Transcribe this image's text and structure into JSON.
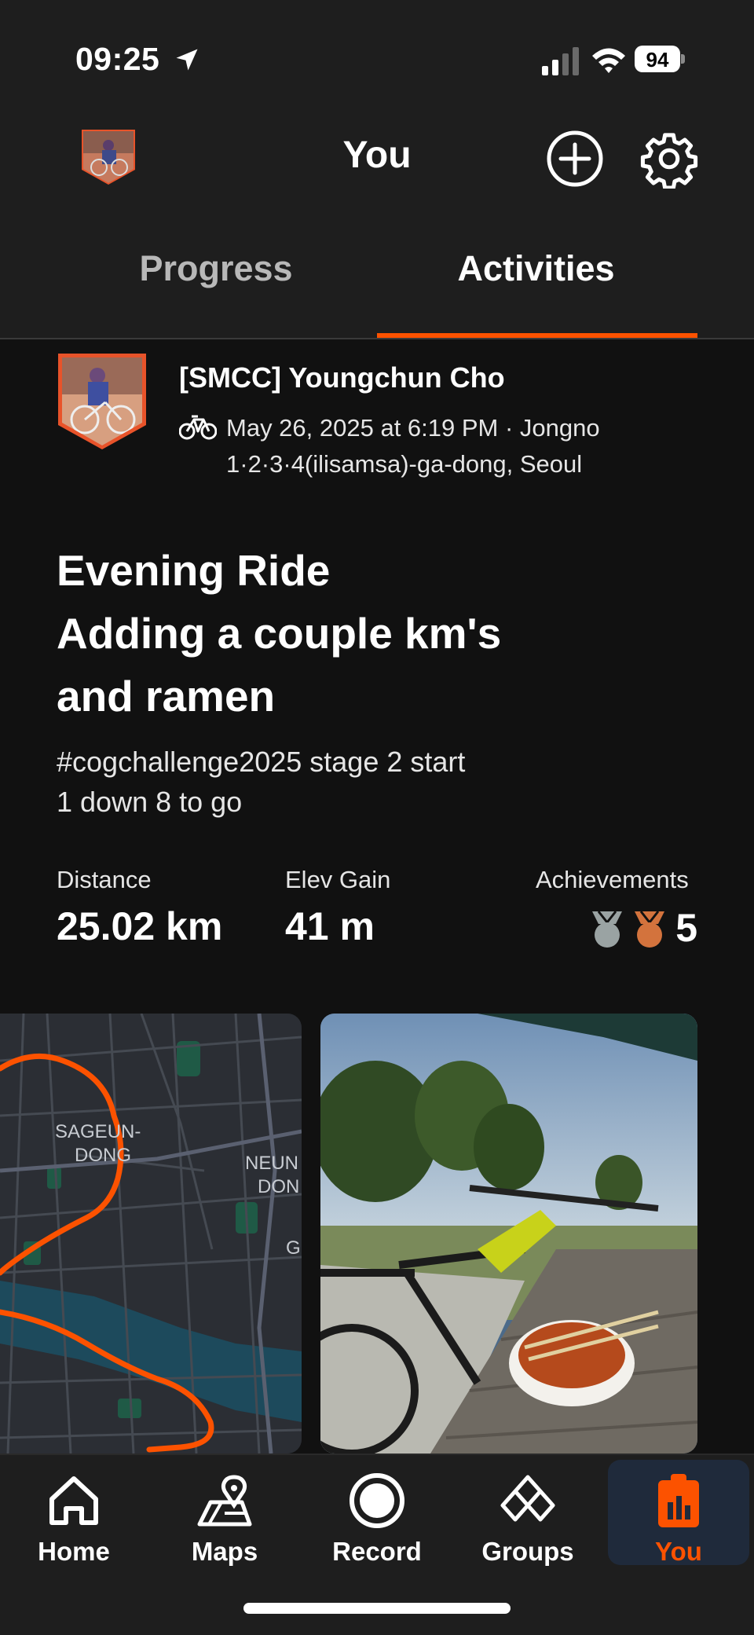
{
  "status_bar": {
    "time": "09:25",
    "battery": "94"
  },
  "header": {
    "title": "You"
  },
  "tabs": [
    {
      "label": "Progress",
      "active": false
    },
    {
      "label": "Activities",
      "active": true
    }
  ],
  "activity": {
    "athlete": "[SMCC] Youngchun Cho",
    "meta_line1": "May 26, 2025 at 6:19 PM · Jongno",
    "meta_line2": "1·2·3·4(ilisamsa)-ga-dong, Seoul",
    "title_line1": "Evening Ride",
    "title_line2": "Adding a couple km's",
    "title_line3": "and ramen",
    "desc_line1": "#cogchallenge2025 stage 2 start",
    "desc_line2": "1 down 8 to go",
    "stats": {
      "distance_label": "Distance",
      "distance_value": "25.02 km",
      "elev_label": "Elev Gain",
      "elev_value": "41 m",
      "ach_label": "Achievements",
      "ach_value": "5"
    },
    "map_labels": {
      "area1_line1": "SAGEUN-",
      "area1_line2": "DONG",
      "area2_line1": "NEUN",
      "area2_line2": "DON",
      "area3": "G"
    }
  },
  "nav": [
    {
      "label": "Home",
      "icon": "home-icon"
    },
    {
      "label": "Maps",
      "icon": "maps-icon"
    },
    {
      "label": "Record",
      "icon": "record-icon"
    },
    {
      "label": "Groups",
      "icon": "groups-icon"
    },
    {
      "label": "You",
      "icon": "you-icon"
    }
  ],
  "colors": {
    "accent": "#fc5200",
    "background": "#111111",
    "surface": "#1e1e1e",
    "route": "#fc5200"
  }
}
